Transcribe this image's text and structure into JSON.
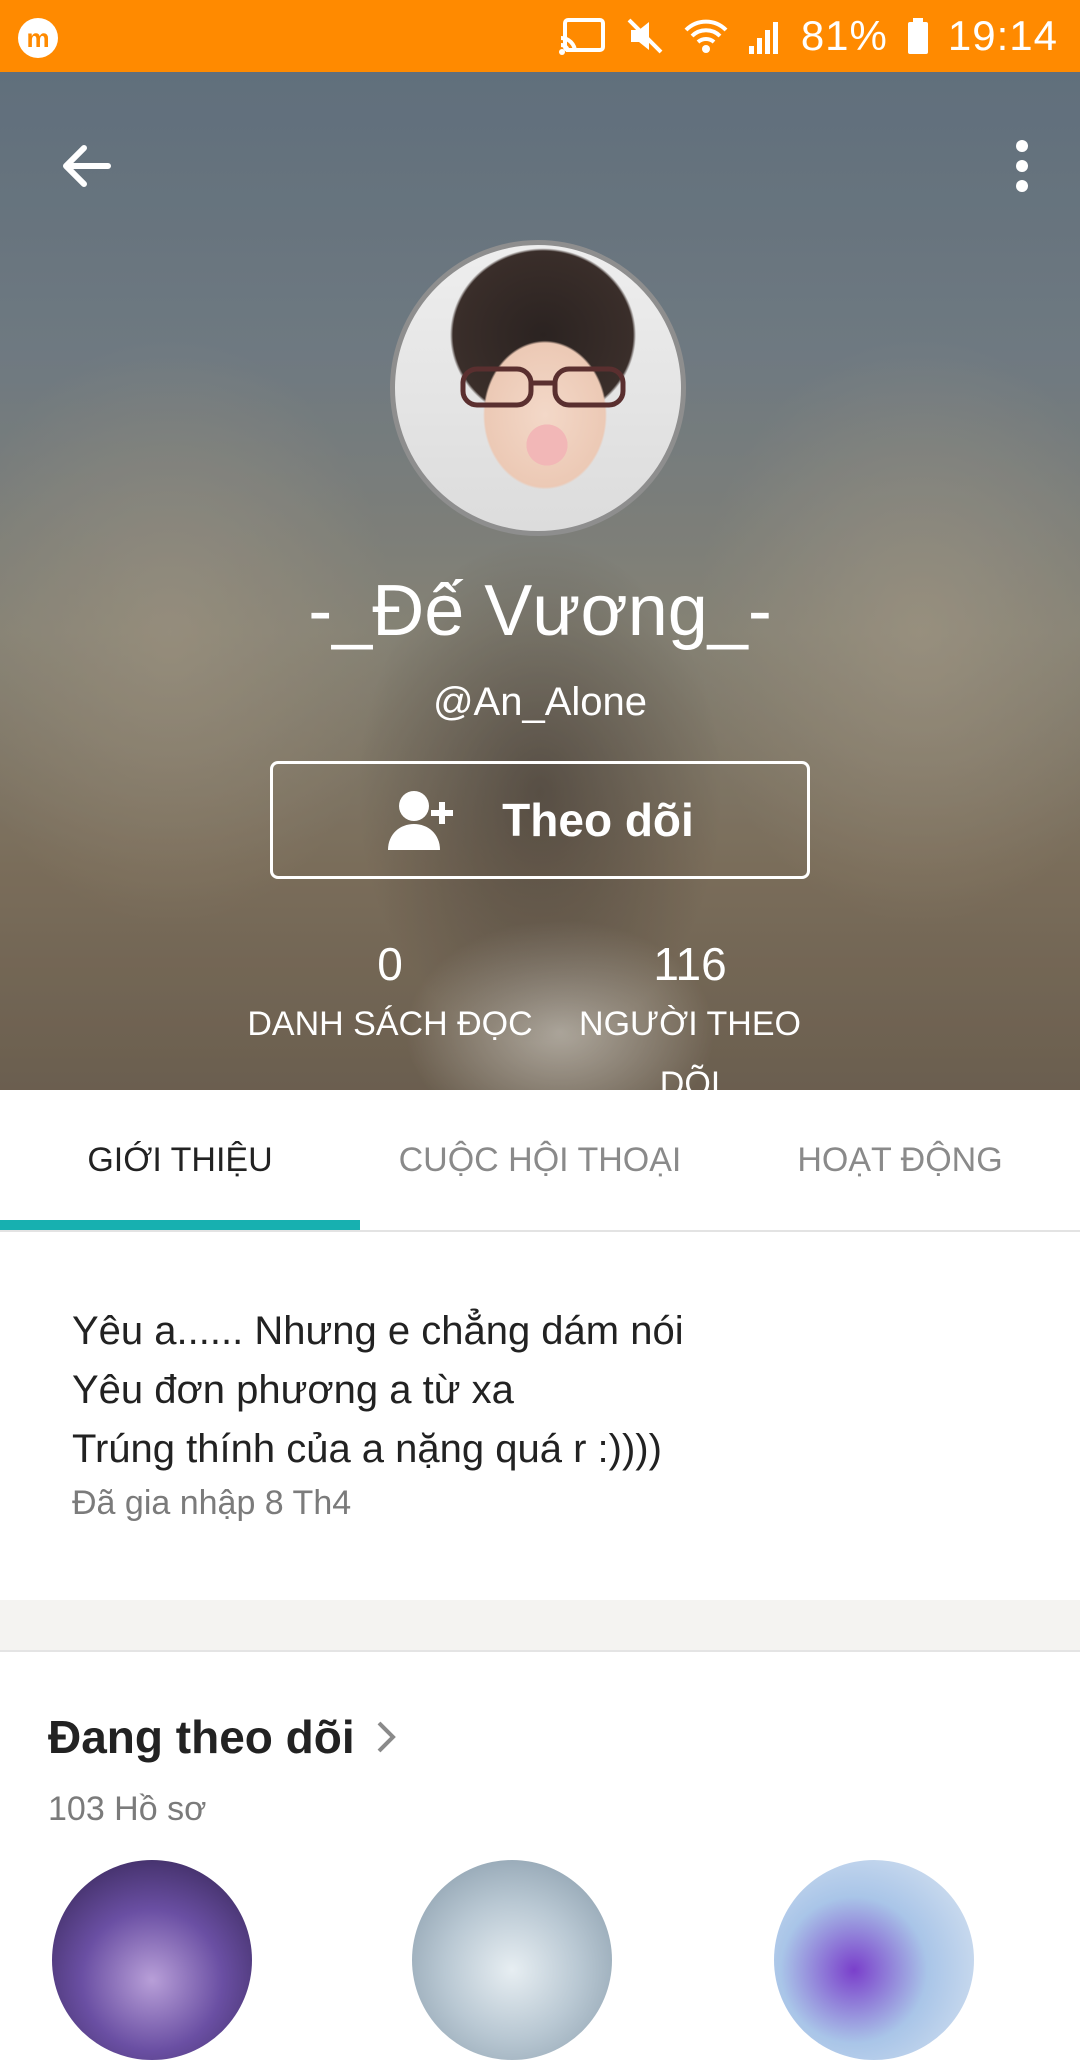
{
  "status_bar": {
    "app_icon": "m",
    "battery": "81%",
    "time": "19:14",
    "icons": [
      "cast-icon",
      "mute-icon",
      "wifi-icon",
      "signal-icon",
      "battery-icon"
    ],
    "bg_color": "#ff8a00"
  },
  "header": {
    "back_icon": "arrow-left-icon",
    "menu_icon": "more-vert-icon"
  },
  "profile": {
    "display_name": "-_Đế Vương_-",
    "username": "@An_Alone",
    "follow_label": "Theo dõi",
    "follow_icon": "add-user-icon",
    "stats": {
      "reading_lists": {
        "value": "0",
        "label": "DANH SÁCH ĐỌC"
      },
      "followers": {
        "value": "116",
        "label": "NGƯỜI THEO DÕI"
      }
    }
  },
  "tabs": [
    {
      "label": "GIỚI THIỆU",
      "active": true
    },
    {
      "label": "CUỘC HỘI THOẠI",
      "active": false
    },
    {
      "label": "HOẠT ĐỘNG",
      "active": false
    }
  ],
  "accent_color": "#17b0b0",
  "about": {
    "bio_lines": [
      "Yêu a...... Nhưng e chẳng dám nói",
      "Yêu đơn phương a từ xa",
      "Trúng thính của a nặng quá r :))))"
    ],
    "joined": "Đã gia nhập 8 Th4"
  },
  "following": {
    "title": "Đang theo dõi",
    "count": "103 Hồ sơ"
  }
}
